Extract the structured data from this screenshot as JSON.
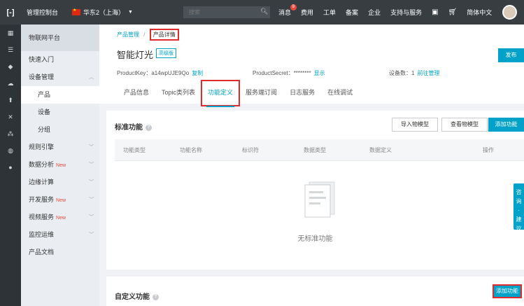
{
  "topbar": {
    "logo": "[-]",
    "console": "管理控制台",
    "region": "华东2（上海）",
    "search_placeholder": "搜索",
    "nav": {
      "messages": "消息",
      "messages_badge": "9",
      "billing": "费用",
      "tickets": "工单",
      "icp": "备案",
      "enterprise": "企业",
      "support": "支持与服务",
      "language": "简体中文"
    }
  },
  "sidenav": {
    "title": "物联网平台",
    "items": [
      {
        "label": "快速入门"
      },
      {
        "label": "设备管理"
      },
      {
        "label": "产品"
      },
      {
        "label": "设备"
      },
      {
        "label": "分组"
      },
      {
        "label": "规则引擎"
      },
      {
        "label": "数据分析",
        "tag": "New"
      },
      {
        "label": "边缘计算"
      },
      {
        "label": "开发服务",
        "tag": "New"
      },
      {
        "label": "视频服务",
        "tag": "New"
      },
      {
        "label": "监控运维"
      },
      {
        "label": "产品文档"
      }
    ]
  },
  "header": {
    "breadcrumb_parent": "产品管理",
    "breadcrumb_current": "产品详情",
    "title": "智能灯光",
    "edition": "高级版",
    "publish": "发布",
    "product_key_label": "ProductKey：a14wpUJE9Qo",
    "copy": "复制",
    "product_secret_label": "ProductSecret：********",
    "show": "显示",
    "device_count_label": "设备数：1",
    "goto_manage": "前往管理",
    "tabs": [
      "产品信息",
      "Topic类列表",
      "功能定义",
      "服务端订阅",
      "日志服务",
      "在线调试"
    ]
  },
  "standard": {
    "title": "标准功能",
    "import_btn": "导入物模型",
    "view_btn": "查看物模型",
    "add_btn": "添加功能",
    "columns": [
      "功能类型",
      "功能名称",
      "标识符",
      "数据类型",
      "数据定义",
      "操作"
    ],
    "empty": "无标准功能"
  },
  "custom": {
    "title": "自定义功能",
    "add_btn": "添加功能"
  },
  "consult": [
    "咨",
    "询",
    "·",
    "建",
    "议"
  ],
  "colors": {
    "accent": "#00a2ca",
    "highlight": "#e12a2a",
    "topbar": "#373d41"
  }
}
